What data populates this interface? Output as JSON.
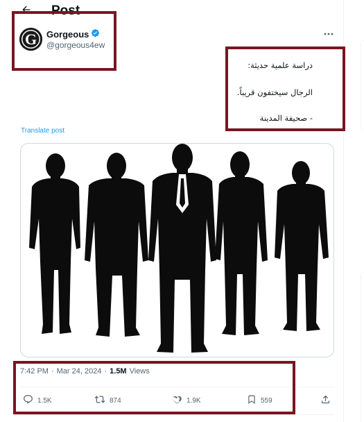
{
  "header": {
    "title": "Post",
    "back_icon": "arrow-left-icon"
  },
  "author": {
    "display_name": "Gorgeous",
    "handle": "@gorgeous4ew",
    "avatar_letter": "G",
    "verified_icon": "verified-badge-icon",
    "verified_color": "#1d9bf0"
  },
  "more_icon": "more-horizontal-icon",
  "tweet": {
    "lines": [
      "دراسة علمية حديثة:",
      "الرجال سيختفون قريباً.",
      "- صحيفة المدينة"
    ]
  },
  "translate_label": "Translate post",
  "media": {
    "subject": "five-men-silhouettes"
  },
  "meta": {
    "time": "7:42 PM",
    "separator": "·",
    "date": "Mar 24, 2024",
    "views_count": "1.5M",
    "views_label": "Views"
  },
  "actions": {
    "reply": {
      "icon": "reply-icon",
      "count": "1.5K"
    },
    "retweet": {
      "icon": "retweet-icon",
      "count": "874"
    },
    "like": {
      "icon": "heart-icon",
      "count": "1.9K"
    },
    "bookmark": {
      "icon": "bookmark-icon",
      "count": "559"
    },
    "share": {
      "icon": "share-icon"
    }
  },
  "colors": {
    "accent": "#1d9bf0",
    "text_primary": "#0f1419",
    "text_secondary": "#536471",
    "annotation_box": "#7a1522"
  }
}
